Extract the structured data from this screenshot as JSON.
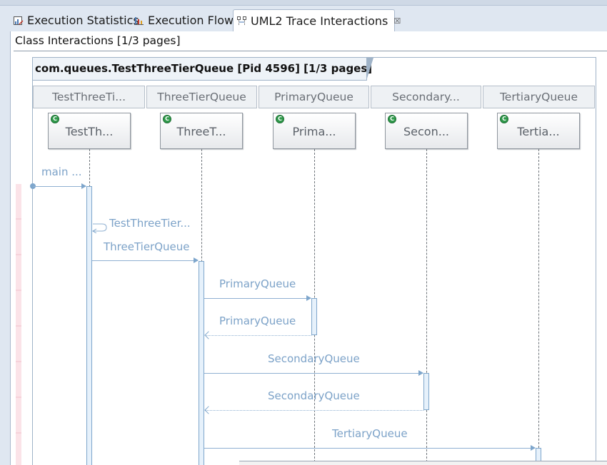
{
  "tabs": [
    {
      "label": "Execution Statistics",
      "icon": "statistics-icon",
      "active": false
    },
    {
      "label": "Execution Flow",
      "icon": "flow-chart-icon",
      "active": false
    },
    {
      "label": "UML2 Trace Interactions",
      "icon": "interaction-icon",
      "active": true,
      "close": "☒"
    }
  ],
  "view": {
    "title": "Class Interactions [1/3 pages]",
    "diagram_title": "com.queues.TestThreeTierQueue [Pid 4596] [1/3 pages]"
  },
  "lanes": [
    {
      "header": "TestThreeTi...",
      "object": "TestTh..."
    },
    {
      "header": "ThreeTierQueue",
      "object": "ThreeT..."
    },
    {
      "header": "PrimaryQueue",
      "object": "Prima..."
    },
    {
      "header": "Secondary...",
      "object": "Secon..."
    },
    {
      "header": "TertiaryQueue",
      "object": "Tertia..."
    }
  ],
  "messages": [
    {
      "label": "main ..."
    },
    {
      "label": "TestThreeTier..."
    },
    {
      "label": "ThreeTierQueue"
    },
    {
      "label": "PrimaryQueue"
    },
    {
      "label": "PrimaryQueue"
    },
    {
      "label": "SecondaryQueue"
    },
    {
      "label": "SecondaryQueue"
    },
    {
      "label": "TertiaryQueue"
    }
  ],
  "colors": {
    "accent": "#7ca2c8",
    "class_icon": "#2f9a4a"
  }
}
